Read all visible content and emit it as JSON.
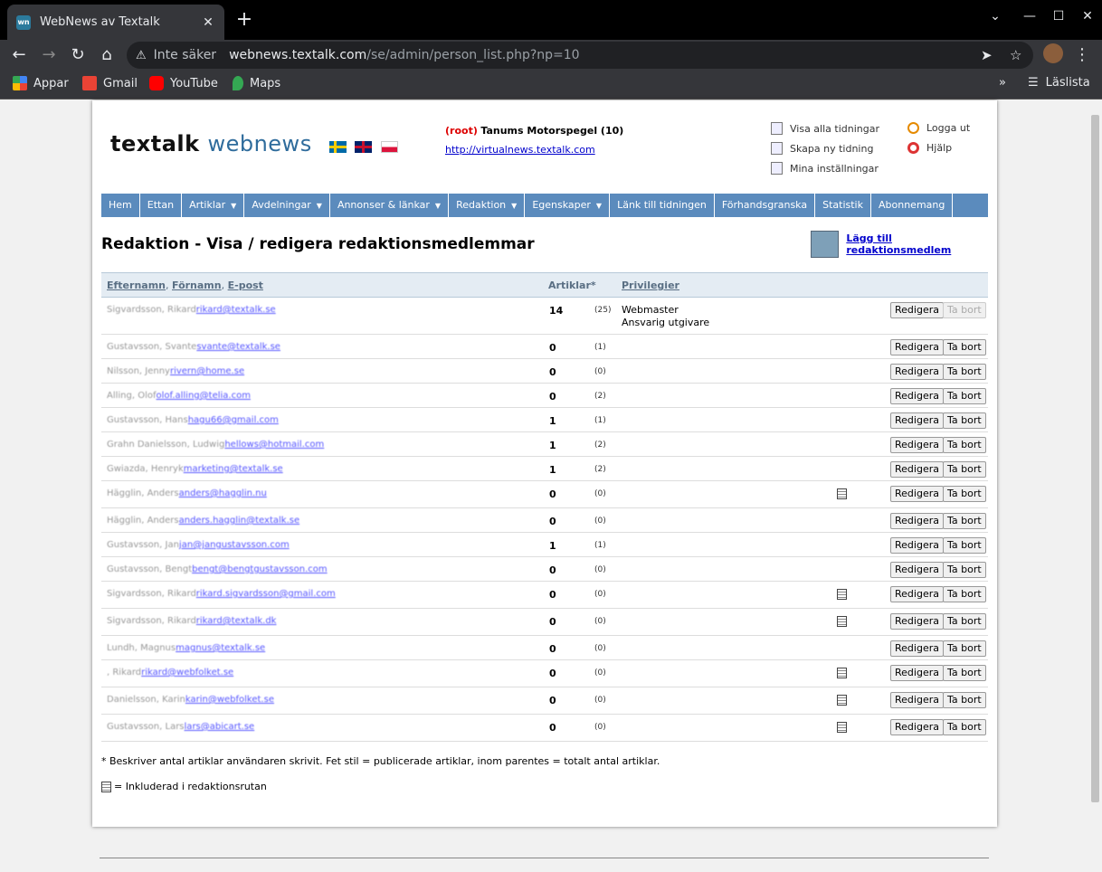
{
  "browser": {
    "tab_title": "WebNews av Textalk",
    "favicon_text": "wn",
    "security_label": "Inte säker",
    "url_host": "webnews.textalk.com",
    "url_path": "/se/admin/person_list.php?np=10",
    "bookmarks": [
      {
        "label": "Appar",
        "color": "#4285f4"
      },
      {
        "label": "Gmail",
        "color": "#ea4335"
      },
      {
        "label": "YouTube",
        "color": "#ff0000"
      },
      {
        "label": "Maps",
        "color": "#34a853"
      }
    ],
    "reading_list": "Läslista"
  },
  "header": {
    "logo_brand": "textalk",
    "logo_product": "webnews",
    "root_label": "(root)",
    "site_name": "Tanums Motorspegel (10)",
    "site_url": "http://virtualnews.textalk.com",
    "quick_links": {
      "show_all": "Visa alla tidningar",
      "create_new": "Skapa ny tidning",
      "my_settings": "Mina inställningar",
      "logout": "Logga ut",
      "help": "Hjälp"
    }
  },
  "menu": [
    {
      "label": "Hem",
      "dropdown": false
    },
    {
      "label": "Ettan",
      "dropdown": false
    },
    {
      "label": "Artiklar",
      "dropdown": true
    },
    {
      "label": "Avdelningar",
      "dropdown": true
    },
    {
      "label": "Annonser & länkar",
      "dropdown": true
    },
    {
      "label": "Redaktion",
      "dropdown": true
    },
    {
      "label": "Egenskaper",
      "dropdown": true
    },
    {
      "label": "Länk till tidningen",
      "dropdown": false
    },
    {
      "label": "Förhandsgranska",
      "dropdown": false
    },
    {
      "label": "Statistik",
      "dropdown": false
    },
    {
      "label": "Abonnemang",
      "dropdown": false
    }
  ],
  "page": {
    "title": "Redaktion - Visa / redigera redaktionsmedlemmar",
    "add_member": "Lägg till redaktionsmedlem",
    "columns": {
      "lastname": "Efternamn",
      "firstname": "Förnamn",
      "email": "E-post",
      "articles": "Artiklar*",
      "privileges": "Privilegier"
    },
    "edit_label": "Redigera",
    "delete_label": "Ta bort",
    "footnote": "* Beskriver antal artiklar användaren skrivit. Fet stil = publicerade artiklar, inom parentes = totalt antal artiklar.",
    "legend": "= Inkluderad i redaktionsrutan"
  },
  "members": [
    {
      "name": "Sigvardsson, Rikard",
      "email": "rikard@textalk.se",
      "pub": "14",
      "tot": "(25)",
      "priv": [
        "Webmaster",
        "Ansvarig utgivare"
      ],
      "inc": false,
      "del_disabled": true
    },
    {
      "name": "Gustavsson, Svante",
      "email": "svante@textalk.se",
      "pub": "0",
      "tot": "(1)",
      "priv": [],
      "inc": false,
      "del_disabled": false
    },
    {
      "name": "Nilsson, Jenny",
      "email": "rivern@home.se",
      "pub": "0",
      "tot": "(0)",
      "priv": [],
      "inc": false,
      "del_disabled": false
    },
    {
      "name": "Alling, Olof",
      "email": "olof.alling@telia.com",
      "pub": "0",
      "tot": "(2)",
      "priv": [],
      "inc": false,
      "del_disabled": false
    },
    {
      "name": "Gustavsson, Hans",
      "email": "hagu66@gmail.com",
      "pub": "1",
      "tot": "(1)",
      "priv": [],
      "inc": false,
      "del_disabled": false
    },
    {
      "name": "Grahn Danielsson, Ludwig",
      "email": "hellows@hotmail.com",
      "pub": "1",
      "tot": "(2)",
      "priv": [],
      "inc": false,
      "del_disabled": false
    },
    {
      "name": "Gwiazda, Henryk",
      "email": "marketing@textalk.se",
      "pub": "1",
      "tot": "(2)",
      "priv": [],
      "inc": false,
      "del_disabled": false
    },
    {
      "name": "Hägglin, Anders",
      "email": "anders@hagglin.nu",
      "pub": "0",
      "tot": "(0)",
      "priv": [],
      "inc": true,
      "del_disabled": false
    },
    {
      "name": "Hägglin, Anders",
      "email": "anders.hagglin@textalk.se",
      "pub": "0",
      "tot": "(0)",
      "priv": [],
      "inc": false,
      "del_disabled": false
    },
    {
      "name": "Gustavsson, Jan",
      "email": "jan@jangustavsson.com",
      "pub": "1",
      "tot": "(1)",
      "priv": [],
      "inc": false,
      "del_disabled": false
    },
    {
      "name": "Gustavsson, Bengt",
      "email": "bengt@bengtgustavsson.com",
      "pub": "0",
      "tot": "(0)",
      "priv": [],
      "inc": false,
      "del_disabled": false
    },
    {
      "name": "Sigvardsson, Rikard",
      "email": "rikard.sigvardsson@gmail.com",
      "pub": "0",
      "tot": "(0)",
      "priv": [],
      "inc": true,
      "del_disabled": false
    },
    {
      "name": "Sigvardsson, Rikard",
      "email": "rikard@textalk.dk",
      "pub": "0",
      "tot": "(0)",
      "priv": [],
      "inc": true,
      "del_disabled": false
    },
    {
      "name": "Lundh, Magnus",
      "email": "magnus@textalk.se",
      "pub": "0",
      "tot": "(0)",
      "priv": [],
      "inc": false,
      "del_disabled": false
    },
    {
      "name": ", Rikard",
      "email": "rikard@webfolket.se",
      "pub": "0",
      "tot": "(0)",
      "priv": [],
      "inc": true,
      "del_disabled": false
    },
    {
      "name": "Danielsson, Karin",
      "email": "karin@webfolket.se",
      "pub": "0",
      "tot": "(0)",
      "priv": [],
      "inc": true,
      "del_disabled": false
    },
    {
      "name": "Gustavsson, Lars",
      "email": "lars@abicart.se",
      "pub": "0",
      "tot": "(0)",
      "priv": [],
      "inc": true,
      "del_disabled": false
    }
  ]
}
